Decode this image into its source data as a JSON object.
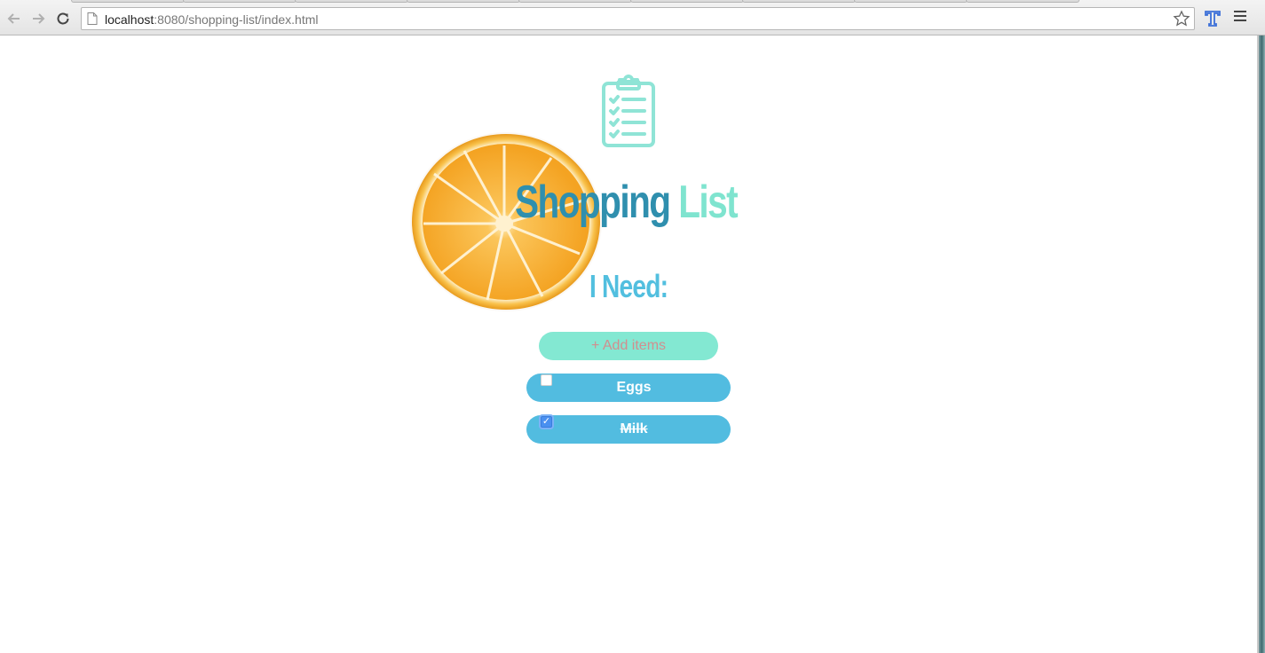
{
  "browser": {
    "url_host": "localhost",
    "url_path": ":8080/shopping-list/index.html"
  },
  "page": {
    "title_part1": "Shopping",
    "title_part2": "List",
    "subtitle": "I Need:",
    "add_placeholder": "+ Add items",
    "items": [
      {
        "label": "Eggs",
        "checked": false
      },
      {
        "label": "Milk",
        "checked": true
      }
    ]
  },
  "colors": {
    "title_primary": "#2f8fae",
    "title_accent": "#7fe4cf",
    "item_background": "#52bce0",
    "add_background": "#83e8d2"
  }
}
